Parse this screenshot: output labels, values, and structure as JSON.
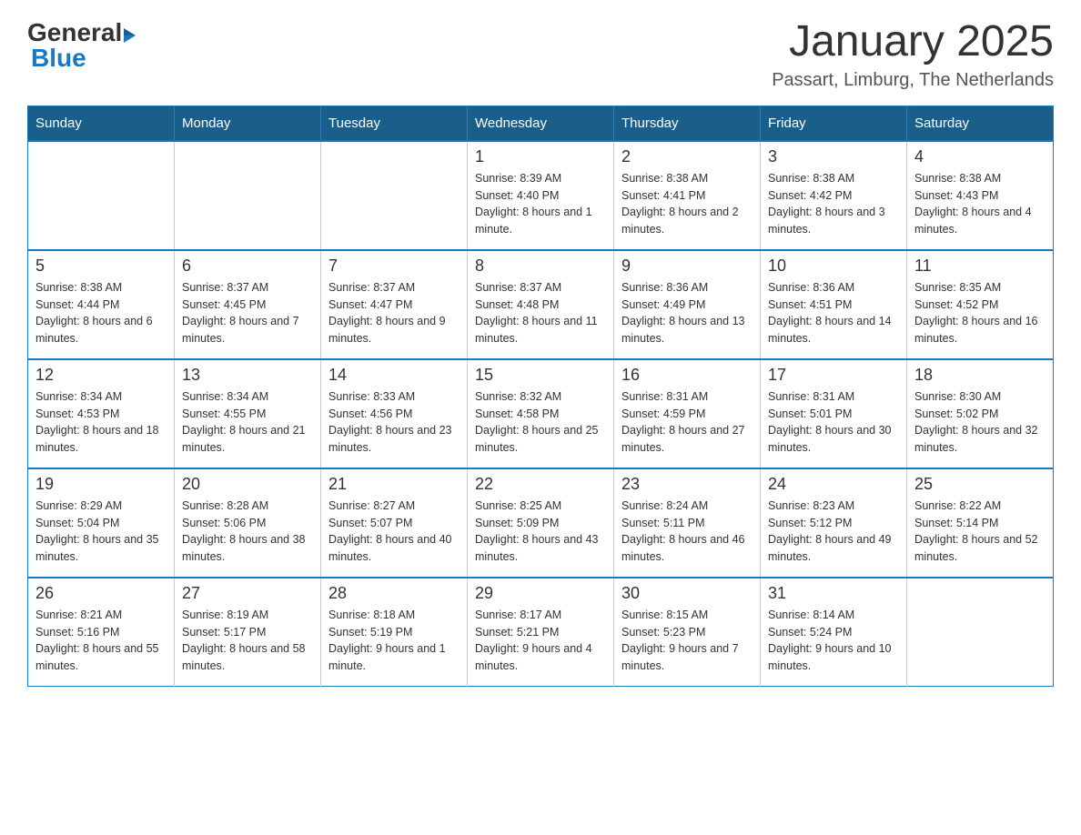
{
  "logo": {
    "general": "General",
    "arrow": "▶",
    "blue": "Blue"
  },
  "title": "January 2025",
  "subtitle": "Passart, Limburg, The Netherlands",
  "days_of_week": [
    "Sunday",
    "Monday",
    "Tuesday",
    "Wednesday",
    "Thursday",
    "Friday",
    "Saturday"
  ],
  "weeks": [
    [
      {
        "day": "",
        "info": ""
      },
      {
        "day": "",
        "info": ""
      },
      {
        "day": "",
        "info": ""
      },
      {
        "day": "1",
        "info": "Sunrise: 8:39 AM\nSunset: 4:40 PM\nDaylight: 8 hours and 1 minute."
      },
      {
        "day": "2",
        "info": "Sunrise: 8:38 AM\nSunset: 4:41 PM\nDaylight: 8 hours and 2 minutes."
      },
      {
        "day": "3",
        "info": "Sunrise: 8:38 AM\nSunset: 4:42 PM\nDaylight: 8 hours and 3 minutes."
      },
      {
        "day": "4",
        "info": "Sunrise: 8:38 AM\nSunset: 4:43 PM\nDaylight: 8 hours and 4 minutes."
      }
    ],
    [
      {
        "day": "5",
        "info": "Sunrise: 8:38 AM\nSunset: 4:44 PM\nDaylight: 8 hours and 6 minutes."
      },
      {
        "day": "6",
        "info": "Sunrise: 8:37 AM\nSunset: 4:45 PM\nDaylight: 8 hours and 7 minutes."
      },
      {
        "day": "7",
        "info": "Sunrise: 8:37 AM\nSunset: 4:47 PM\nDaylight: 8 hours and 9 minutes."
      },
      {
        "day": "8",
        "info": "Sunrise: 8:37 AM\nSunset: 4:48 PM\nDaylight: 8 hours and 11 minutes."
      },
      {
        "day": "9",
        "info": "Sunrise: 8:36 AM\nSunset: 4:49 PM\nDaylight: 8 hours and 13 minutes."
      },
      {
        "day": "10",
        "info": "Sunrise: 8:36 AM\nSunset: 4:51 PM\nDaylight: 8 hours and 14 minutes."
      },
      {
        "day": "11",
        "info": "Sunrise: 8:35 AM\nSunset: 4:52 PM\nDaylight: 8 hours and 16 minutes."
      }
    ],
    [
      {
        "day": "12",
        "info": "Sunrise: 8:34 AM\nSunset: 4:53 PM\nDaylight: 8 hours and 18 minutes."
      },
      {
        "day": "13",
        "info": "Sunrise: 8:34 AM\nSunset: 4:55 PM\nDaylight: 8 hours and 21 minutes."
      },
      {
        "day": "14",
        "info": "Sunrise: 8:33 AM\nSunset: 4:56 PM\nDaylight: 8 hours and 23 minutes."
      },
      {
        "day": "15",
        "info": "Sunrise: 8:32 AM\nSunset: 4:58 PM\nDaylight: 8 hours and 25 minutes."
      },
      {
        "day": "16",
        "info": "Sunrise: 8:31 AM\nSunset: 4:59 PM\nDaylight: 8 hours and 27 minutes."
      },
      {
        "day": "17",
        "info": "Sunrise: 8:31 AM\nSunset: 5:01 PM\nDaylight: 8 hours and 30 minutes."
      },
      {
        "day": "18",
        "info": "Sunrise: 8:30 AM\nSunset: 5:02 PM\nDaylight: 8 hours and 32 minutes."
      }
    ],
    [
      {
        "day": "19",
        "info": "Sunrise: 8:29 AM\nSunset: 5:04 PM\nDaylight: 8 hours and 35 minutes."
      },
      {
        "day": "20",
        "info": "Sunrise: 8:28 AM\nSunset: 5:06 PM\nDaylight: 8 hours and 38 minutes."
      },
      {
        "day": "21",
        "info": "Sunrise: 8:27 AM\nSunset: 5:07 PM\nDaylight: 8 hours and 40 minutes."
      },
      {
        "day": "22",
        "info": "Sunrise: 8:25 AM\nSunset: 5:09 PM\nDaylight: 8 hours and 43 minutes."
      },
      {
        "day": "23",
        "info": "Sunrise: 8:24 AM\nSunset: 5:11 PM\nDaylight: 8 hours and 46 minutes."
      },
      {
        "day": "24",
        "info": "Sunrise: 8:23 AM\nSunset: 5:12 PM\nDaylight: 8 hours and 49 minutes."
      },
      {
        "day": "25",
        "info": "Sunrise: 8:22 AM\nSunset: 5:14 PM\nDaylight: 8 hours and 52 minutes."
      }
    ],
    [
      {
        "day": "26",
        "info": "Sunrise: 8:21 AM\nSunset: 5:16 PM\nDaylight: 8 hours and 55 minutes."
      },
      {
        "day": "27",
        "info": "Sunrise: 8:19 AM\nSunset: 5:17 PM\nDaylight: 8 hours and 58 minutes."
      },
      {
        "day": "28",
        "info": "Sunrise: 8:18 AM\nSunset: 5:19 PM\nDaylight: 9 hours and 1 minute."
      },
      {
        "day": "29",
        "info": "Sunrise: 8:17 AM\nSunset: 5:21 PM\nDaylight: 9 hours and 4 minutes."
      },
      {
        "day": "30",
        "info": "Sunrise: 8:15 AM\nSunset: 5:23 PM\nDaylight: 9 hours and 7 minutes."
      },
      {
        "day": "31",
        "info": "Sunrise: 8:14 AM\nSunset: 5:24 PM\nDaylight: 9 hours and 10 minutes."
      },
      {
        "day": "",
        "info": ""
      }
    ]
  ]
}
